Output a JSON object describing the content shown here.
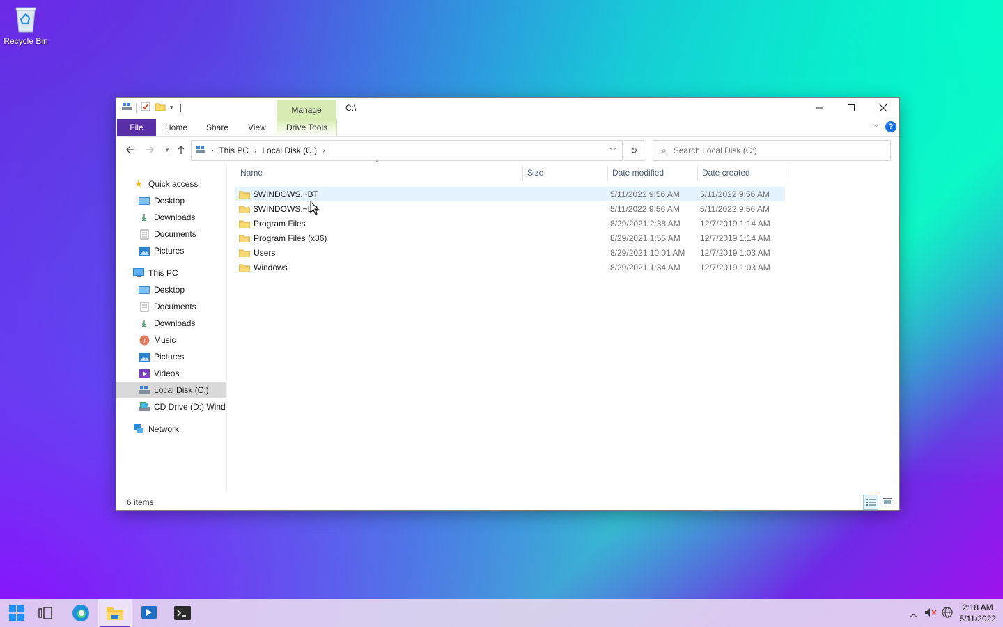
{
  "desktop": {
    "recycle_bin_label": "Recycle Bin"
  },
  "window": {
    "contextual_tab": "Manage",
    "title": "C:\\",
    "ribbon_tabs": {
      "file": "File",
      "home": "Home",
      "share": "Share",
      "view": "View",
      "drive_tools": "Drive Tools"
    },
    "address": {
      "crumbs": [
        "This PC",
        "Local Disk (C:)"
      ]
    },
    "search_placeholder": "Search Local Disk (C:)",
    "nav": {
      "quick_access": "Quick access",
      "qa_items": [
        "Desktop",
        "Downloads",
        "Documents",
        "Pictures"
      ],
      "this_pc": "This PC",
      "pc_items": [
        "Desktop",
        "Documents",
        "Downloads",
        "Music",
        "Pictures",
        "Videos",
        "Local Disk (C:)",
        "CD Drive (D:) Windows"
      ],
      "network": "Network"
    },
    "columns": {
      "name": "Name",
      "size": "Size",
      "date_modified": "Date modified",
      "date_created": "Date created"
    },
    "files": [
      {
        "name": "$WINDOWS.~BT",
        "modified": "5/11/2022 9:56 AM",
        "created": "5/11/2022 9:56 AM"
      },
      {
        "name": "$WINDOWS.~LS",
        "modified": "5/11/2022 9:56 AM",
        "created": "5/11/2022 9:56 AM"
      },
      {
        "name": "Program Files",
        "modified": "8/29/2021 2:38 AM",
        "created": "12/7/2019 1:14 AM"
      },
      {
        "name": "Program Files (x86)",
        "modified": "8/29/2021 1:55 AM",
        "created": "12/7/2019 1:14 AM"
      },
      {
        "name": "Users",
        "modified": "8/29/2021 10:01 AM",
        "created": "12/7/2019 1:03 AM"
      },
      {
        "name": "Windows",
        "modified": "8/29/2021 1:34 AM",
        "created": "12/7/2019 1:03 AM"
      }
    ],
    "status": "6 items"
  },
  "taskbar": {
    "time": "2:18 AM",
    "date": "5/11/2022"
  },
  "colors": {
    "file_tab": "#5a2ea6",
    "manage_tab": "#d6ecb2",
    "folder": "#f8d775",
    "selection": "#e5f3ff"
  }
}
